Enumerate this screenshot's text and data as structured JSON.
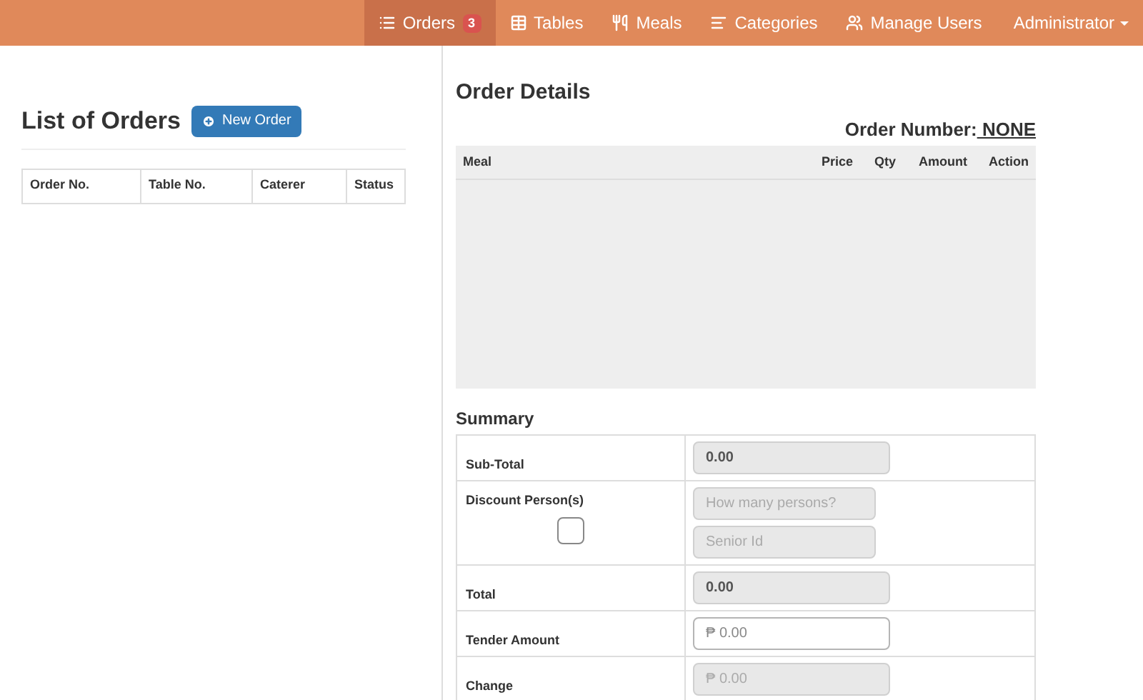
{
  "navbar": {
    "items": [
      {
        "label": "Orders",
        "kind": "list",
        "badge": "3",
        "selected": true
      },
      {
        "label": "Tables",
        "kind": "table",
        "selected": false
      },
      {
        "label": "Meals",
        "kind": "utensils",
        "selected": false
      },
      {
        "label": "Categories",
        "kind": "categories",
        "selected": false
      },
      {
        "label": "Manage Users",
        "kind": "users",
        "selected": false
      }
    ],
    "user_menu": {
      "label": "Administrator"
    }
  },
  "orders_panel": {
    "title": "List of Orders",
    "new_button": "New Order",
    "columns": [
      "Order No.",
      "Table No.",
      "Caterer",
      "Status"
    ]
  },
  "order_details": {
    "title": "Order Details",
    "order_number_label": "Order Number:",
    "order_number": " NONE",
    "columns": [
      "Meal",
      "Price",
      "Qty",
      "Amount",
      "Action"
    ]
  },
  "summary": {
    "title": "Summary",
    "rows": [
      {
        "kind": "value",
        "label": "Sub-Total",
        "field": {
          "value": "0.00",
          "disabled": true
        }
      },
      {
        "kind": "discount",
        "label": "Discount Person(s)",
        "checked": false,
        "fields": [
          {
            "placeholder": "How many persons?",
            "disabled": true
          },
          {
            "placeholder": "Senior Id",
            "disabled": true
          }
        ]
      },
      {
        "kind": "value",
        "label": "Total",
        "field": {
          "value": "0.00",
          "disabled": true
        }
      },
      {
        "kind": "value",
        "label": "Tender Amount",
        "field": {
          "placeholder": "₱ 0.00",
          "disabled": false
        }
      },
      {
        "kind": "value",
        "label": "Change",
        "field": {
          "placeholder": "₱ 0.00",
          "disabled": true
        }
      }
    ]
  }
}
